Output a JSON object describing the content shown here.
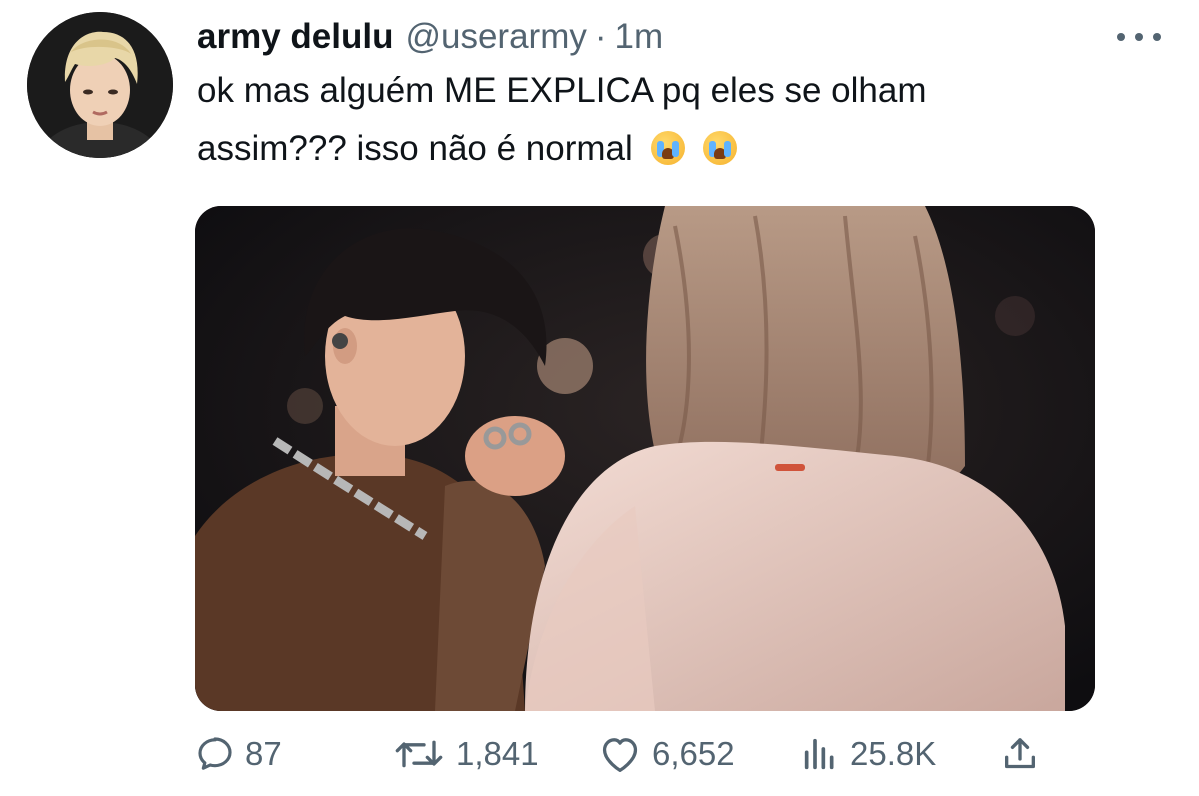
{
  "user": {
    "display_name": "army delulu",
    "handle": "@userarmy",
    "separator": "·",
    "time": "1m",
    "avatar_icon": "profile-photo"
  },
  "tweet": {
    "text_line1": "ok mas alguém ME EXPLICA pq eles se olham",
    "text_line2": "assim??? isso não é normal",
    "emoji": "loudly-crying-face"
  },
  "media": {
    "type": "photo"
  },
  "actions": {
    "replies": "87",
    "retweets": "1,841",
    "likes": "6,652",
    "views": "25.8K"
  },
  "colors": {
    "text": "#0f1419",
    "secondary": "#536471",
    "background": "#ffffff"
  }
}
